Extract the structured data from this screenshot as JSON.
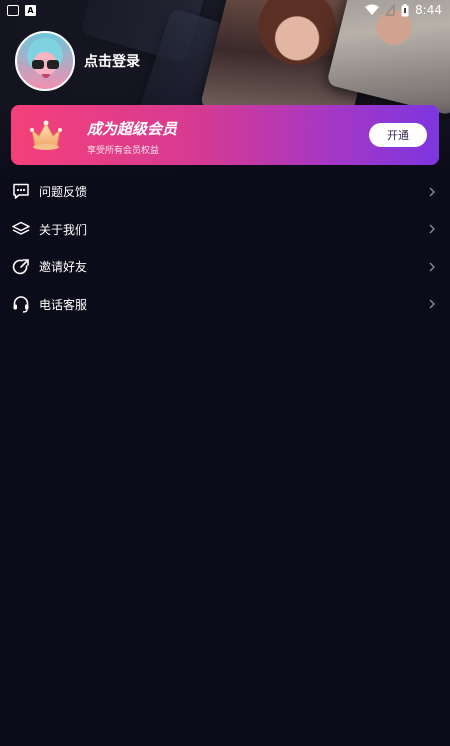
{
  "status_bar": {
    "time": "8:44",
    "left_icons": [
      "mail-icon",
      "a-icon"
    ],
    "right_icons": [
      "wifi-icon",
      "battery-icon"
    ]
  },
  "profile": {
    "login_text": "点击登录"
  },
  "vip": {
    "title": "成为超级会员",
    "subtitle": "享受所有会员权益",
    "button_label": "开通",
    "colors": {
      "start": "#f5407a",
      "end": "#7d36e0"
    }
  },
  "menu": {
    "items": [
      {
        "label": "问题反馈",
        "icon": "chat-dots-icon"
      },
      {
        "label": "关于我们",
        "icon": "layers-icon"
      },
      {
        "label": "邀请好友",
        "icon": "share-icon"
      },
      {
        "label": "电话客服",
        "icon": "headset-icon"
      }
    ]
  },
  "colors": {
    "background": "#0b0b1a",
    "text": "#ffffff",
    "chevron": "#8a8a99"
  }
}
